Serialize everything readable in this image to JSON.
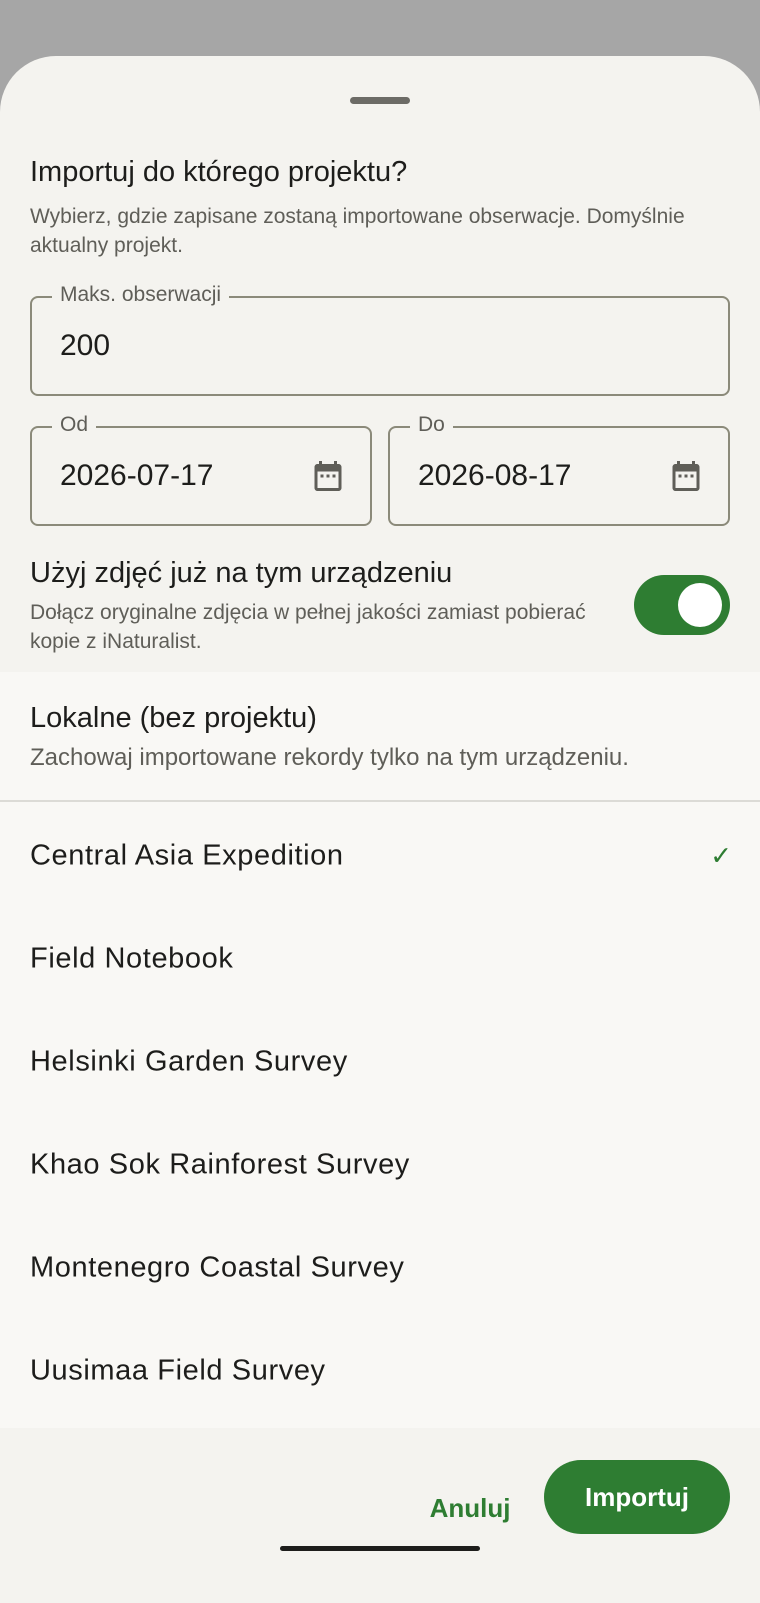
{
  "dialog": {
    "title": "Importuj do którego projektu?",
    "subtitle": "Wybierz, gdzie zapisane zostaną importowane obserwacje. Domyślnie aktualny projekt."
  },
  "max_field": {
    "label": "Maks. obserwacji",
    "value": "200"
  },
  "date_from": {
    "label": "Od",
    "value": "2026-07-17",
    "icon": "calendar-icon"
  },
  "date_to": {
    "label": "Do",
    "value": "2026-08-17",
    "icon": "calendar-icon"
  },
  "photos": {
    "title": "Użyj zdjęć już na tym urządzeniu",
    "description": "Dołącz oryginalne zdjęcia w pełnej jakości zamiast pobierać kopie z iNaturalist.",
    "enabled": true
  },
  "local_option": {
    "title": "Lokalne (bez projektu)",
    "description": "Zachowaj importowane rekordy tylko na tym urządzeniu."
  },
  "projects": [
    {
      "name": "Central Asia Expedition",
      "selected": true
    },
    {
      "name": "Field Notebook",
      "selected": false
    },
    {
      "name": "Helsinki Garden Survey",
      "selected": false
    },
    {
      "name": "Khao Sok Rainforest Survey",
      "selected": false
    },
    {
      "name": "Montenegro Coastal Survey",
      "selected": false
    },
    {
      "name": "Uusimaa Field Survey",
      "selected": false
    }
  ],
  "check_mark": "✓",
  "buttons": {
    "cancel": "Anuluj",
    "import": "Importuj"
  },
  "colors": {
    "accent": "#2e7d32",
    "sheet": "#f4f3ef",
    "scrim": "#a6a6a6"
  }
}
